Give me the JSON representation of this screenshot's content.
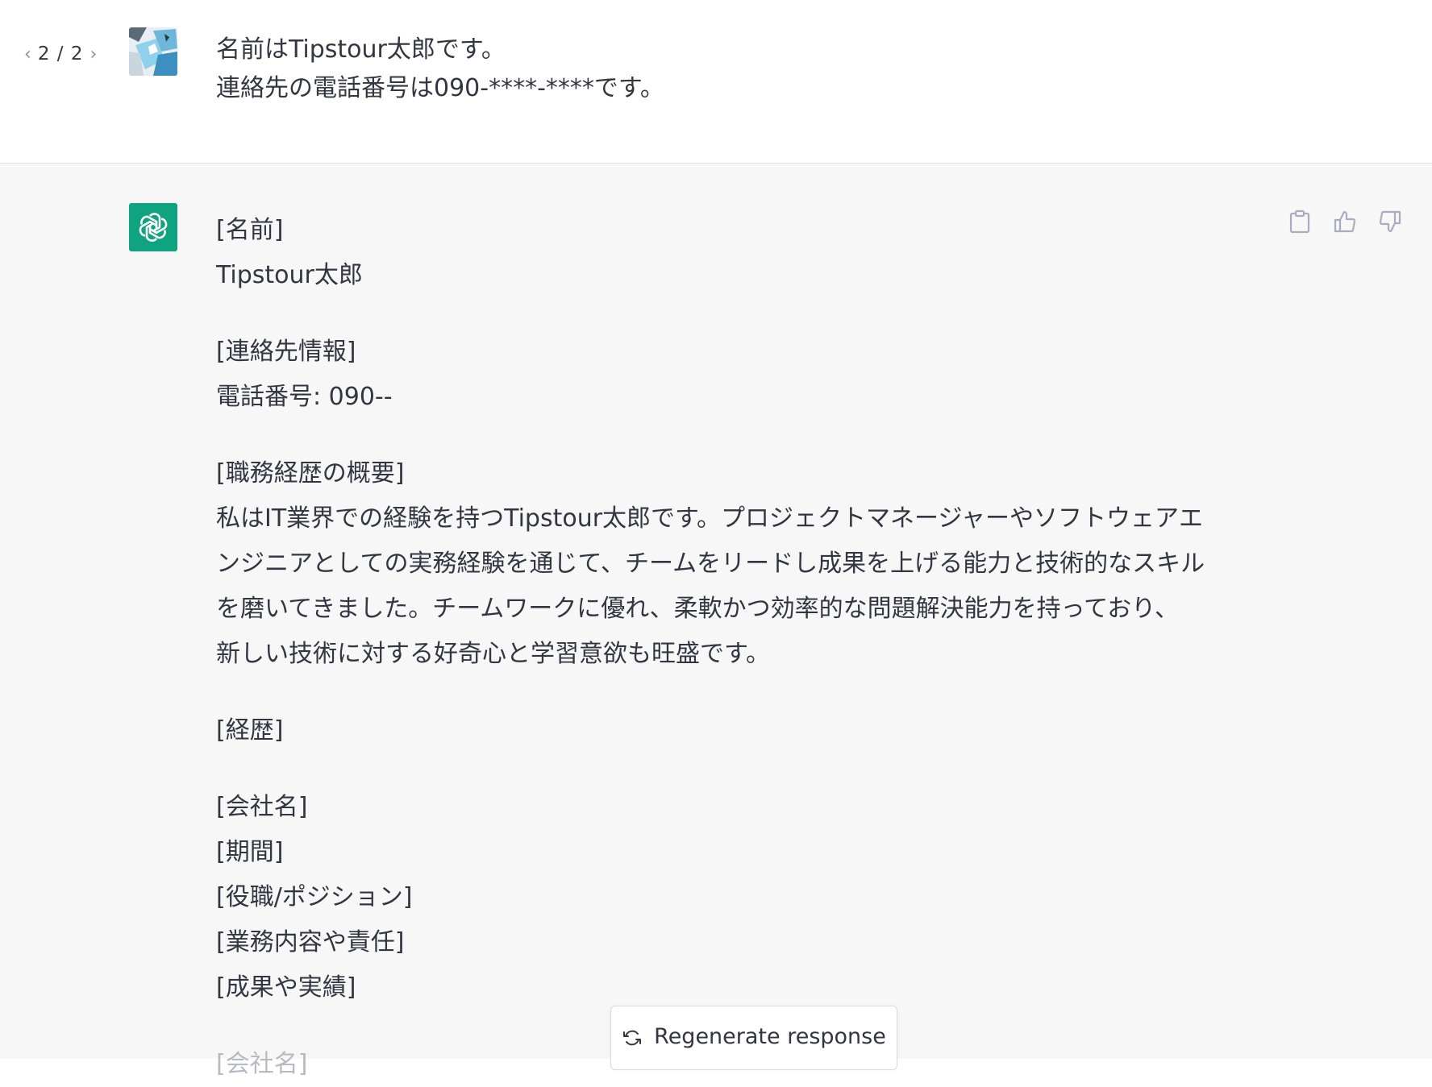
{
  "pager": {
    "current_total": "2 / 2"
  },
  "user_message": {
    "lines": [
      "名前はTipstour太郎です。",
      "連絡先の電話番号は090-****-****です。"
    ]
  },
  "response": {
    "name_header": "[名前]",
    "name_value": "Tipstour太郎",
    "contact_header": "[連絡先情報]",
    "phone": "電話番号: 090--",
    "summary_header": "[職務経歴の概要]",
    "summary_lines": [
      "私はIT業界での経験を持つTipstour太郎です。プロジェクトマネージャーやソフトウェアエ",
      "ンジニアとしての実務経験を通じて、チームをリードし成果を上げる能力と技術的なスキル",
      "を磨いてきました。チームワークに優れ、柔軟かつ効率的な問題解決能力を持っており、",
      "新しい技術に対する好奇心と学習意欲も旺盛です。"
    ],
    "history_header": "[経歴]",
    "company": "[会社名]",
    "period": "[期間]",
    "position": "[役職/ポジション]",
    "duties": "[業務内容や責任]",
    "achievements": "[成果や実績]",
    "company_next": "[会社名]"
  },
  "actions": {
    "copy": "clipboard-icon",
    "like": "thumbs-up-icon",
    "dislike": "thumbs-down-icon"
  },
  "regenerate": {
    "label": "Regenerate response"
  },
  "colors": {
    "accent": "#10a37f",
    "text": "#343541",
    "assistant_bg": "#f7f7f8"
  }
}
